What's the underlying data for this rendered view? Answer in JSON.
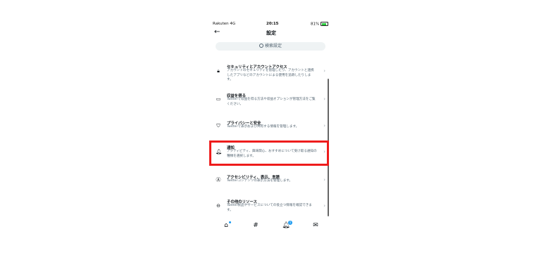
{
  "status_bar": {
    "carrier": "Rakuten 4G",
    "time": "20:15",
    "battery": "81%"
  },
  "header": {
    "title": "設定"
  },
  "search": {
    "placeholder": "検索設定"
  },
  "items": [
    {
      "title": "セキュリティとアカウントアクセス",
      "desc": "アカウントのセキュリティを管理したり、アカウントと連携したアプリなどのアカウントによる使用を追跡したりします。",
      "icon": "lock-icon"
    },
    {
      "title": "収益を得る",
      "desc": "Twitterで収益を得る方法や収益オプションが管理方法をご覧ください。",
      "icon": "money-icon"
    },
    {
      "title": "プライバシーと安全",
      "desc": "Twitterで表示および共有する情報を管理します。",
      "icon": "shield-icon"
    },
    {
      "title": "通知",
      "desc": "アクティビティ、興味関心、おすすめについて受け取る通知の種類を選択します。",
      "icon": "bell-icon"
    },
    {
      "title": "アクセシビリティ、表示、言語",
      "desc": "Twitterコンテンツの表示方法を管理します。",
      "icon": "accessibility-icon"
    },
    {
      "title": "その他のリソース",
      "desc": "Twitter製品やサービスについての役立つ情報を確認できます。",
      "icon": "more-icon"
    }
  ],
  "tabbar": {
    "notification_badge": "1"
  }
}
